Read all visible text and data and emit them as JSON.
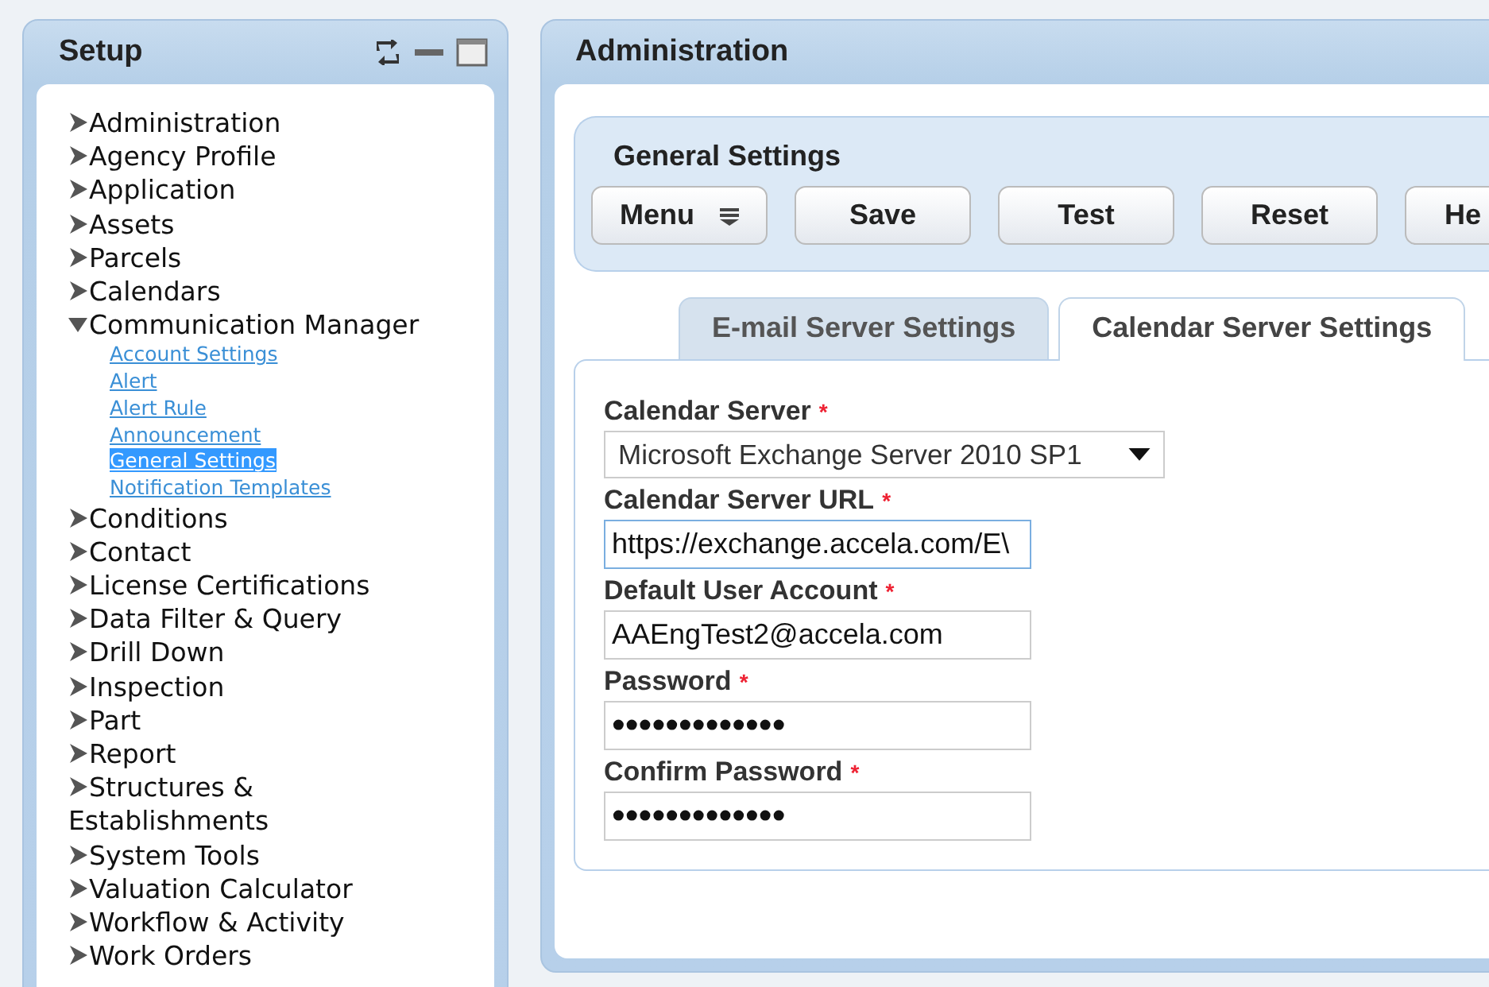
{
  "sidebar": {
    "title": "Setup",
    "items": [
      {
        "label": "Administration",
        "expanded": false
      },
      {
        "label": "Agency Profile",
        "expanded": false
      },
      {
        "label": "Application",
        "expanded": false
      },
      {
        "label": "Assets",
        "expanded": false
      },
      {
        "label": "Parcels",
        "expanded": false
      },
      {
        "label": "Calendars",
        "expanded": false
      },
      {
        "label": "Communication Manager",
        "expanded": true,
        "children": [
          {
            "label": "Account Settings",
            "selected": false
          },
          {
            "label": "Alert",
            "selected": false
          },
          {
            "label": "Alert Rule",
            "selected": false
          },
          {
            "label": "Announcement",
            "selected": false
          },
          {
            "label": "General Settings",
            "selected": true
          },
          {
            "label": "Notification Templates",
            "selected": false
          }
        ]
      },
      {
        "label": "Conditions",
        "expanded": false
      },
      {
        "label": "Contact",
        "expanded": false
      },
      {
        "label": "License Certifications",
        "expanded": false
      },
      {
        "label": "Data Filter & Query",
        "expanded": false
      },
      {
        "label": "Drill Down",
        "expanded": false
      },
      {
        "label": "Inspection",
        "expanded": false
      },
      {
        "label": "Part",
        "expanded": false
      },
      {
        "label": "Report",
        "expanded": false
      },
      {
        "label": "Structures & Establishments",
        "expanded": false
      },
      {
        "label": "System Tools",
        "expanded": false
      },
      {
        "label": "Valuation Calculator",
        "expanded": false
      },
      {
        "label": "Workflow & Activity",
        "expanded": false
      },
      {
        "label": "Work Orders",
        "expanded": false
      }
    ]
  },
  "main": {
    "title": "Administration",
    "section_title": "General Settings",
    "buttons": [
      {
        "label": "Menu",
        "kind": "menu"
      },
      {
        "label": "Save",
        "kind": "plain"
      },
      {
        "label": "Test",
        "kind": "plain"
      },
      {
        "label": "Reset",
        "kind": "plain"
      },
      {
        "label": "He",
        "kind": "cut"
      }
    ],
    "tabs": [
      {
        "label": "E-mail Server Settings",
        "selected": false
      },
      {
        "label": "Calendar Server Settings",
        "selected": true
      }
    ],
    "fields": [
      {
        "label": "Calendar Server",
        "required_mark": "*",
        "kind": "select",
        "value": "Microsoft Exchange Server 2010 SP1"
      },
      {
        "label": "Calendar Server URL",
        "required_mark": "*",
        "kind": "text",
        "value": "https://exchange.accela.com/E\\",
        "focused": true
      },
      {
        "label": "Default User Account",
        "required_mark": "*",
        "kind": "text",
        "value": "AAEngTest2@accela.com",
        "focused": false
      },
      {
        "label": "Password",
        "required_mark": "*",
        "kind": "password",
        "value": "•••••••••••••",
        "focused": false
      },
      {
        "label": "Confirm Password",
        "required_mark": "*",
        "kind": "password",
        "value": "•••••••••••••",
        "focused": false
      }
    ]
  }
}
